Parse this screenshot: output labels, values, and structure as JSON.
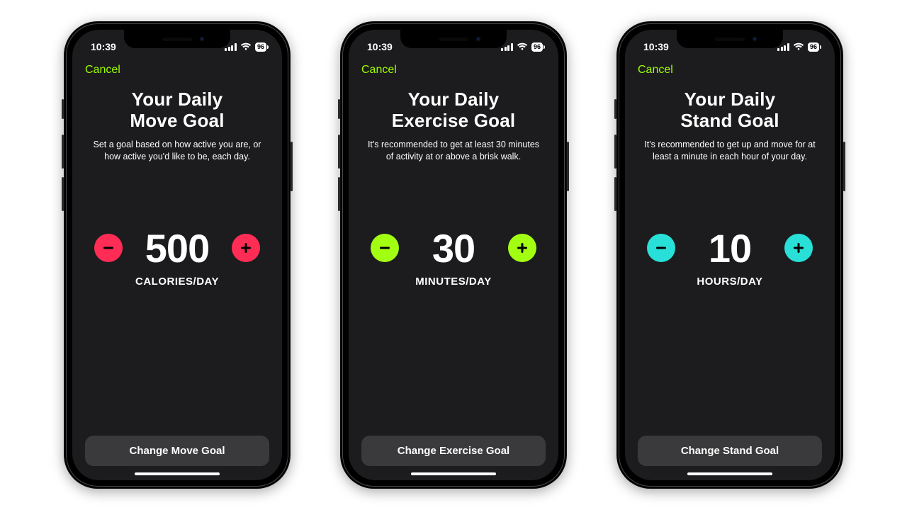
{
  "status": {
    "time": "10:39",
    "battery": "96"
  },
  "nav": {
    "cancel": "Cancel"
  },
  "colors": {
    "move": "#ff2d55",
    "exercise": "#a3ff12",
    "stand": "#28e0d8",
    "accent_text": "#9dff00"
  },
  "screens": [
    {
      "key": "move",
      "title": "Your Daily\nMove Goal",
      "subtitle": "Set a goal based on how active you are, or how active you'd like to be, each day.",
      "value": "500",
      "unit": "CALORIES/DAY",
      "cta": "Change Move Goal",
      "btn_color_key": "move"
    },
    {
      "key": "exercise",
      "title": "Your Daily\nExercise Goal",
      "subtitle": "It's recommended to get at least 30 minutes of activity at or above a brisk walk.",
      "value": "30",
      "unit": "MINUTES/DAY",
      "cta": "Change Exercise Goal",
      "btn_color_key": "exercise"
    },
    {
      "key": "stand",
      "title": "Your Daily\nStand Goal",
      "subtitle": "It's recommended to get up and move for at least a minute in each hour of your day.",
      "value": "10",
      "unit": "HOURS/DAY",
      "cta": "Change Stand Goal",
      "btn_color_key": "stand"
    }
  ]
}
